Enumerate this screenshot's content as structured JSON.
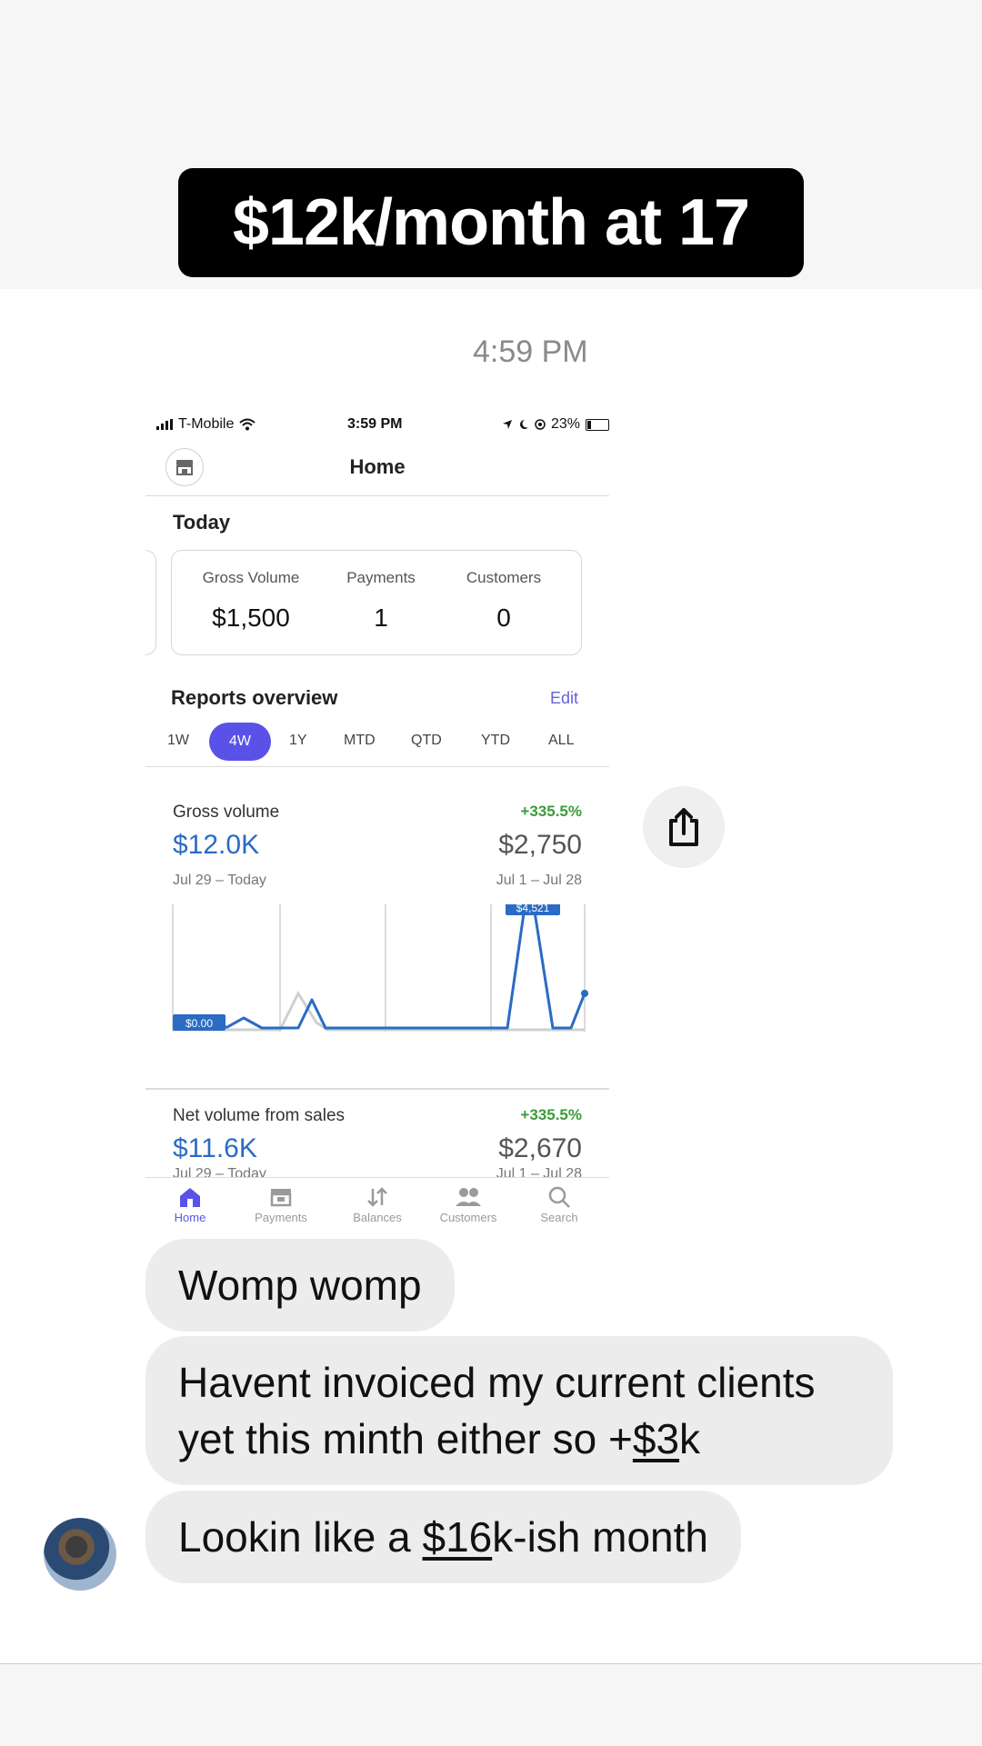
{
  "story": {
    "headline": "$12k/month at 17",
    "message_time": "4:59 PM"
  },
  "phone": {
    "status": {
      "carrier": "T-Mobile",
      "time": "3:59 PM",
      "battery": "23%"
    },
    "header": {
      "title": "Home"
    },
    "today": {
      "title": "Today",
      "stats": [
        {
          "label": "Gross Volume",
          "value": "$1,500"
        },
        {
          "label": "Payments",
          "value": "1"
        },
        {
          "label": "Customers",
          "value": "0"
        }
      ]
    },
    "reports": {
      "title": "Reports overview",
      "edit_label": "Edit",
      "tabs": [
        "1W",
        "4W",
        "1Y",
        "MTD",
        "QTD",
        "YTD",
        "ALL"
      ],
      "active_tab": "4W"
    },
    "gross_volume": {
      "label": "Gross volume",
      "value": "$12.0K",
      "range": "Jul 29 – Today",
      "change": "+335.5%",
      "previous_value": "$2,750",
      "previous_range": "Jul 1 – Jul 28",
      "peak_label": "$4,521",
      "start_label": "$0.00"
    },
    "net_volume": {
      "label": "Net volume from sales",
      "value": "$11.6K",
      "range": "Jul 29 – Today",
      "change": "+335.5%",
      "previous_value": "$2,670",
      "previous_range": "Jul 1 – Jul 28"
    },
    "tabbar": [
      {
        "label": "Home",
        "icon": "home-icon"
      },
      {
        "label": "Payments",
        "icon": "payments-icon"
      },
      {
        "label": "Balances",
        "icon": "balances-icon"
      },
      {
        "label": "Customers",
        "icon": "customers-icon"
      },
      {
        "label": "Search",
        "icon": "search-icon"
      }
    ],
    "active_tab": "Home"
  },
  "messages": [
    {
      "text": "Womp womp"
    },
    {
      "parts": [
        "Havent invoiced my current clients",
        "yet this minth either so +",
        "$3",
        "k"
      ]
    },
    {
      "parts": [
        "Lookin like a ",
        "$16",
        "k-ish month"
      ]
    }
  ],
  "colors": {
    "accent": "#5a52e8",
    "link_blue": "#2a6bc4",
    "positive_green": "#3a9c3a",
    "bubble_grey": "#ececec",
    "headline_bg": "#000000"
  }
}
